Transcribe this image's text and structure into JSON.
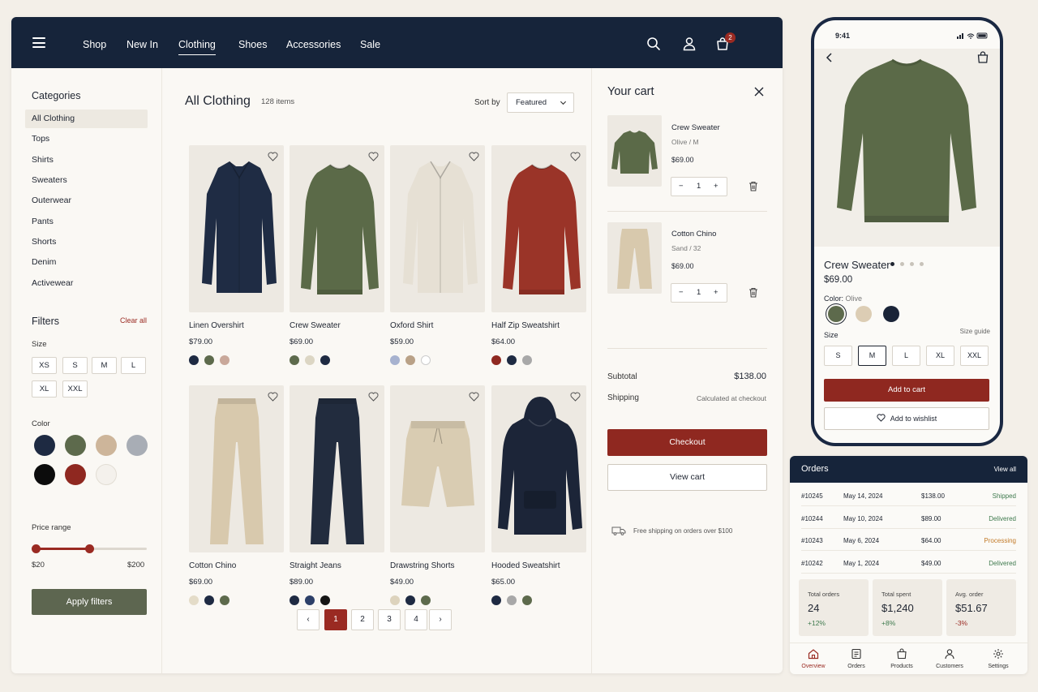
{
  "nav": {
    "links": [
      "Shop",
      "New In",
      "Clothing",
      "Shoes",
      "Accessories",
      "Sale"
    ],
    "active": "Clothing",
    "cart_count": "2"
  },
  "sidebar": {
    "categories_heading": "Categories",
    "categories": [
      "All Clothing",
      "Tops",
      "Shirts",
      "Sweaters",
      "Outerwear",
      "Pants",
      "Shorts",
      "Denim",
      "Activewear"
    ],
    "filters_heading": "Filters",
    "clear_all": "Clear all",
    "size_label": "Size",
    "sizes": [
      "XS",
      "S",
      "M",
      "L",
      "XL",
      "XXL"
    ],
    "color_label": "Color",
    "colors": [
      "#1e2a42",
      "#5d6a4c",
      "#cdb59a",
      "#a8adb5",
      "#0c0c0c",
      "#8f2820",
      "#f4f1ec"
    ],
    "price_label": "Price range",
    "price_min": "$20",
    "price_max": "$200",
    "price_range_fraction": [
      0.0,
      0.48
    ],
    "apply": "Apply filters"
  },
  "listing": {
    "title": "All Clothing",
    "count": "128 items",
    "sort_label": "Sort by",
    "sort_value": "Featured",
    "products": [
      {
        "name": "Linen Overshirt",
        "price": "$79.00",
        "colors": [
          "#1e2a42",
          "#5d6a4c",
          "#c9a89a"
        ],
        "kind": "shirt",
        "color": "#1f2c44"
      },
      {
        "name": "Crew Sweater",
        "price": "$69.00",
        "colors": [
          "#5d6a4c",
          "#dcd6c4",
          "#1e2a42"
        ],
        "kind": "sweater",
        "color": "#5b6a48"
      },
      {
        "name": "Oxford Shirt",
        "price": "$59.00",
        "colors": [
          "#a7b2cf",
          "#b9a187",
          "#ffffff"
        ],
        "kind": "shirt",
        "color": "#e6e0d4"
      },
      {
        "name": "Half Zip Sweatshirt",
        "price": "$64.00",
        "colors": [
          "#8f2820",
          "#1e2a42",
          "#a8a8a8"
        ],
        "kind": "sweater",
        "color": "#9a3428"
      },
      {
        "name": "Cotton Chino",
        "price": "$69.00",
        "colors": [
          "#e4dcc8",
          "#1e2a42",
          "#5d6a4c"
        ],
        "kind": "pants",
        "color": "#d8c9ad"
      },
      {
        "name": "Straight Jeans",
        "price": "$89.00",
        "colors": [
          "#1e2a42",
          "#2c3f68",
          "#151515"
        ],
        "kind": "pants",
        "color": "#222c3e"
      },
      {
        "name": "Drawstring Shorts",
        "price": "$49.00",
        "colors": [
          "#ddd3bd",
          "#1e2a42",
          "#5d6a4c"
        ],
        "kind": "shorts",
        "color": "#d9ccb2"
      },
      {
        "name": "Hooded Sweatshirt",
        "price": "$65.00",
        "colors": [
          "#1e2a42",
          "#a8a8a8",
          "#5d6a4c"
        ],
        "kind": "hoodie",
        "color": "#1c2538"
      }
    ],
    "pages": [
      "1",
      "2",
      "3",
      "4"
    ],
    "current_page": "1"
  },
  "cart": {
    "title": "Your cart",
    "items": [
      {
        "name": "Crew Sweater",
        "variant": "Olive / M",
        "price": "$69.00",
        "qty": "1"
      },
      {
        "name": "Cotton Chino",
        "variant": "Sand / 32",
        "price": "$69.00",
        "qty": "1"
      }
    ],
    "subtotal_label": "Subtotal",
    "subtotal": "$138.00",
    "shipping_label": "Shipping",
    "shipping": "Calculated at checkout",
    "checkout": "Checkout",
    "view_cart": "View cart",
    "shipping_note": "Free shipping on orders over $100"
  },
  "phone": {
    "time": "9:41",
    "product_name": "Crew Sweater",
    "price": "$69.00",
    "color_label": "Color:",
    "color_value": "Olive",
    "swatches": [
      "#5d6a4c",
      "#dccdb4",
      "#1a2438"
    ],
    "size_label": "Size",
    "size_guide": "Size guide",
    "sizes": [
      "S",
      "M",
      "L",
      "XL",
      "XXL"
    ],
    "selected_size": "M",
    "add_to_cart": "Add to cart",
    "add_to_wishlist": "Add to wishlist"
  },
  "orders": {
    "title": "Orders",
    "view_all": "View all",
    "rows": [
      {
        "id": "#10245",
        "date": "May 14, 2024",
        "amount": "$138.00",
        "status": "Shipped",
        "status_color": "#3f7a4e"
      },
      {
        "id": "#10244",
        "date": "May 10, 2024",
        "amount": "$89.00",
        "status": "Delivered",
        "status_color": "#3f7a4e"
      },
      {
        "id": "#10243",
        "date": "May 6, 2024",
        "amount": "$64.00",
        "status": "Processing",
        "status_color": "#c27a28"
      },
      {
        "id": "#10242",
        "date": "May 1, 2024",
        "amount": "$49.00",
        "status": "Delivered",
        "status_color": "#3f7a4e"
      }
    ],
    "stats": [
      {
        "label": "Total orders",
        "value": "24",
        "delta": "+12%",
        "delta_color": "#3f7a4e"
      },
      {
        "label": "Total spent",
        "value": "$1,240",
        "delta": "+8%",
        "delta_color": "#3f7a4e"
      },
      {
        "label": "Avg. order",
        "value": "$51.67",
        "delta": "-3%",
        "delta_color": "#9a2a22"
      }
    ],
    "tabs": [
      "Overview",
      "Orders",
      "Products",
      "Customers",
      "Settings"
    ],
    "active_tab": "Overview"
  }
}
